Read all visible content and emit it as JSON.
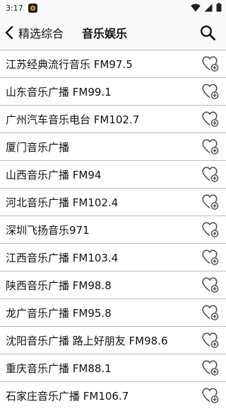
{
  "status_bar": {
    "time": "3:17"
  },
  "header": {
    "back_label": "精选综合",
    "title": "音乐娱乐"
  },
  "stations": [
    "江苏经典流行音乐 FM97.5",
    "山东音乐广播 FM99.1",
    "广州汽车音乐电台 FM102.7",
    "厦门音乐广播",
    "山西音乐广播 FM94",
    "河北音乐广播 FM102.4",
    "深圳飞扬音乐971",
    "江西音乐广播 FM103.4",
    "陕西音乐广播 FM98.8",
    "龙广音乐广播 FM95.8",
    "沈阳音乐广播 路上好朋友 FM98.6",
    "重庆音乐广播 FM88.1",
    "石家庄音乐广播 FM106.7"
  ],
  "icons": {
    "back": "chevron-left-icon",
    "search": "search-icon",
    "favorite": "heart-plus-icon",
    "wifi": "wifi-icon",
    "signal": "signal-icon",
    "battery": "battery-icon"
  }
}
